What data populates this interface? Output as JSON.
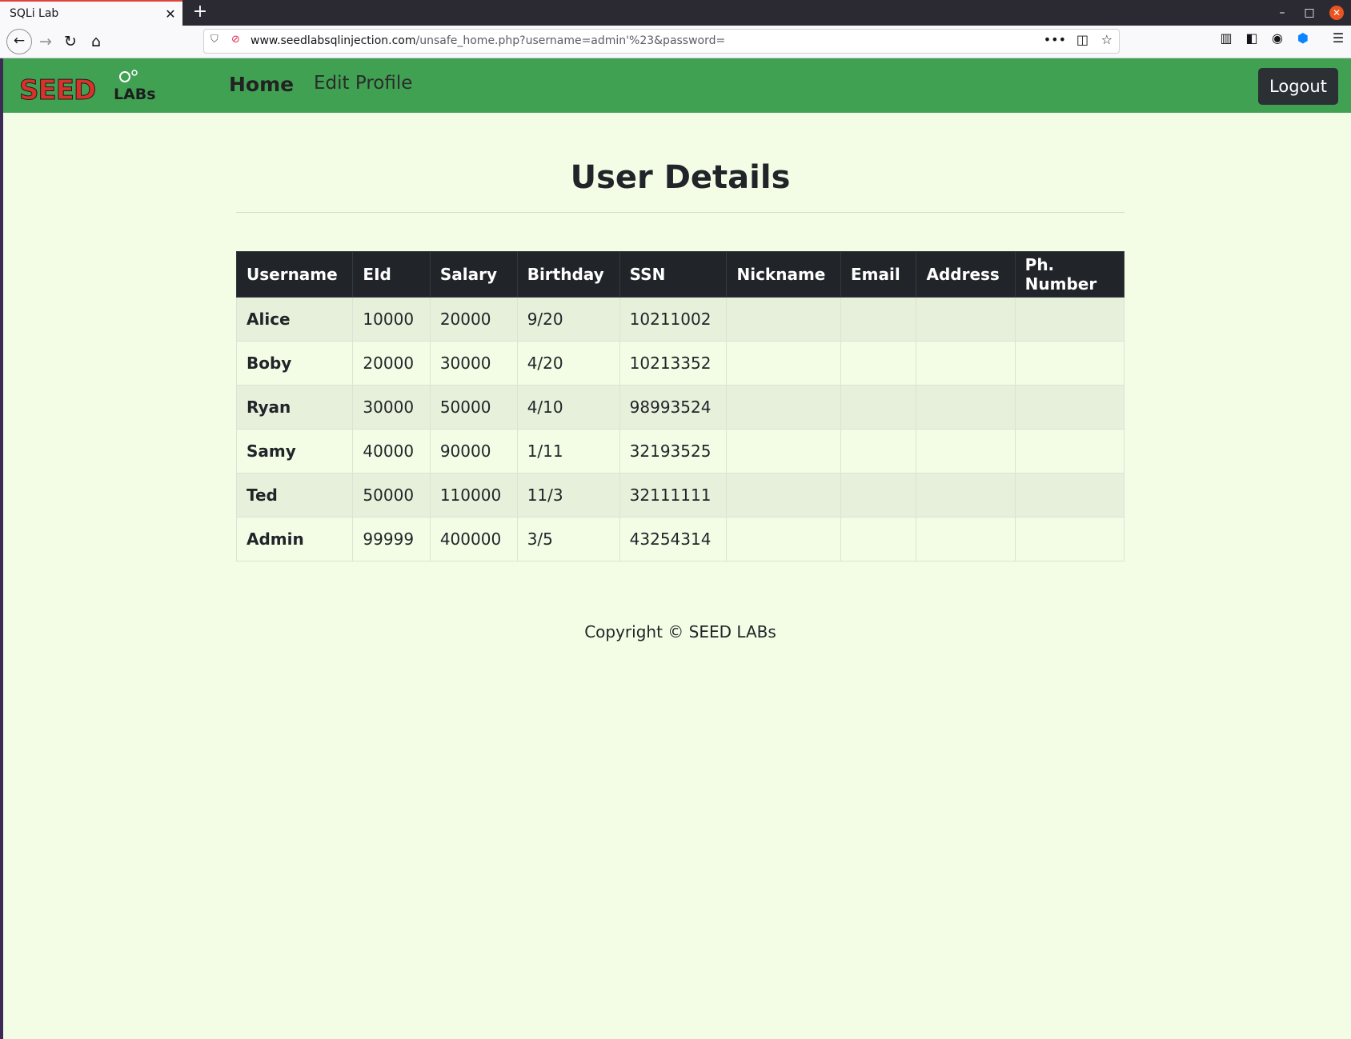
{
  "browser": {
    "tab_title": "SQLi Lab",
    "tab_close": "✕",
    "new_tab": "+",
    "url_domain": "www.seedlabsqlinjection.com",
    "url_path": "/unsafe_home.php?username=admin'%23&password=",
    "more_label": "•••",
    "window_minimize": "–",
    "window_maximize": "□",
    "window_close": "✕"
  },
  "nav": {
    "home_label": "Home",
    "edit_profile_label": "Edit Profile",
    "logout_label": "Logout",
    "logo_text": "SEED LABs"
  },
  "page": {
    "title": "User Details"
  },
  "table": {
    "headers": [
      "Username",
      "EId",
      "Salary",
      "Birthday",
      "SSN",
      "Nickname",
      "Email",
      "Address",
      "Ph. Number"
    ],
    "rows": [
      [
        "Alice",
        "10000",
        "20000",
        "9/20",
        "10211002",
        "",
        "",
        "",
        ""
      ],
      [
        "Boby",
        "20000",
        "30000",
        "4/20",
        "10213352",
        "",
        "",
        "",
        ""
      ],
      [
        "Ryan",
        "30000",
        "50000",
        "4/10",
        "98993524",
        "",
        "",
        "",
        ""
      ],
      [
        "Samy",
        "40000",
        "90000",
        "1/11",
        "32193525",
        "",
        "",
        "",
        ""
      ],
      [
        "Ted",
        "50000",
        "110000",
        "11/3",
        "32111111",
        "",
        "",
        "",
        ""
      ],
      [
        "Admin",
        "99999",
        "400000",
        "3/5",
        "43254314",
        "",
        "",
        "",
        ""
      ]
    ]
  },
  "footer": {
    "text": "Copyright © SEED LABs"
  },
  "colors": {
    "navbar_green": "#41a152",
    "page_background": "#f3fde6",
    "table_header": "#212529",
    "logout_button": "#2b3035",
    "logo_red": "#d8322a"
  }
}
